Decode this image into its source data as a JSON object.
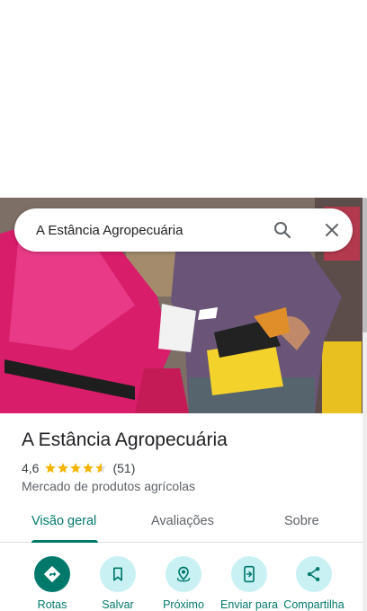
{
  "search": {
    "query": "A Estância Agropecuária"
  },
  "place": {
    "title": "A Estância Agropecuária",
    "rating": "4,6",
    "rating_stars": 4.6,
    "review_count": "(51)",
    "category": "Mercado de produtos agrícolas"
  },
  "tabs": [
    {
      "label": "Visão geral",
      "active": true
    },
    {
      "label": "Avaliações",
      "active": false
    },
    {
      "label": "Sobre",
      "active": false
    }
  ],
  "actions": [
    {
      "label": "Rotas",
      "icon": "directions-icon"
    },
    {
      "label": "Salvar",
      "icon": "bookmark-icon"
    },
    {
      "label": "Próximo",
      "icon": "nearby-icon"
    },
    {
      "label": "Enviar para",
      "icon": "send-to-phone-icon"
    },
    {
      "label": "Compartilha",
      "icon": "share-icon"
    }
  ],
  "colors": {
    "accent": "#00796b",
    "action_bg": "#c9f1f4",
    "star": "#f4b400"
  }
}
